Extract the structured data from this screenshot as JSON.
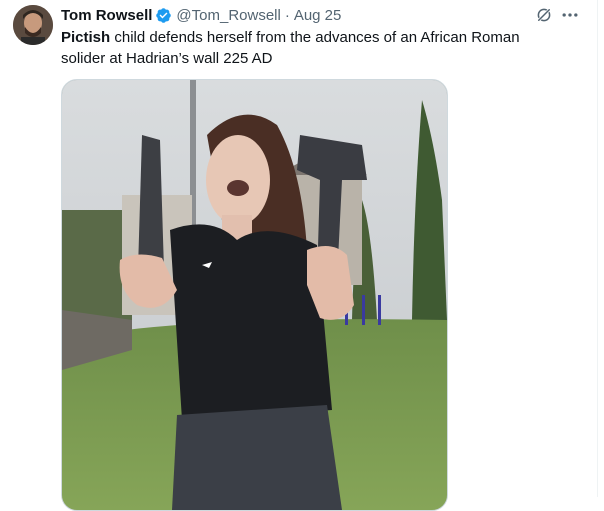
{
  "tweet": {
    "author": {
      "display_name": "Tom Rowsell",
      "handle": "@Tom_Rowsell",
      "verified": true,
      "avatar_icon": "author-avatar"
    },
    "separator": "·",
    "date": "Aug 25",
    "text_bold": "Pictish",
    "text_rest": " child defends herself from the advances of an African Roman solider at Hadrian’s wall 225 AD",
    "media": {
      "type": "video-thumbnail"
    },
    "actions": {
      "grok_icon": "grok-icon",
      "more_icon": "more-icon"
    }
  },
  "colors": {
    "text_primary": "#0f1419",
    "text_secondary": "#536471",
    "verified_blue": "#1d9bf0",
    "border": "#cfd9de"
  }
}
